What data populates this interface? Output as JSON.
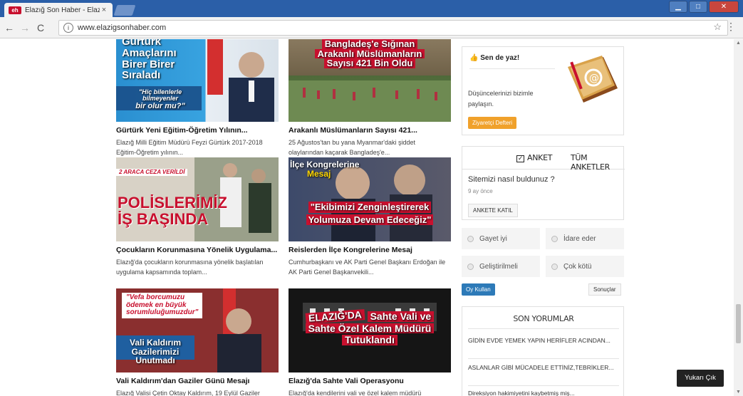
{
  "browser": {
    "tab_title": "Elazığ Son Haber - Elazığ",
    "favicon_text": "eh",
    "tab_close": "×",
    "url": "www.elazigsonhaber.com",
    "back": "←",
    "forward": "→",
    "reload": "C",
    "info": "i",
    "star": "☆",
    "menu": "⋮",
    "win_min": "▁",
    "win_max": "□",
    "win_close": "✕"
  },
  "news": [
    {
      "headline": "Gürtürk Yeni Eğitim-Öğretim Yılının...",
      "summary": "Elazığ Milli Eğitim Müdürü Feyzi Gürtürk  2017-2018 Eğitim-Öğretim yılının...",
      "overlay_lines": [
        "Gürtürk",
        "Amaçlarını",
        "Birer Birer",
        "Sıraladı"
      ],
      "overlay_quote": [
        "\"Hiç bilenlerle bilmeyenler",
        "bir olur mu?\""
      ]
    },
    {
      "headline": "Arakanlı Müslümanların Sayısı 421...",
      "summary": "25 Ağustos'tan bu yana Myanmar'daki şiddet olaylarından kaçarak Bangladeş'e...",
      "overlay_lines": [
        "Bangladeş'e Sığınan",
        "Arakanlı Müslümanların",
        "Sayısı 421 Bin Oldu"
      ]
    },
    {
      "headline": "Çocukların Korunmasına Yönelik Uygulama...",
      "summary": "Elazığ'da çocukların korunmasına yönelik başlatılan uygulama kapsamında toplam...",
      "overlay_lines": [
        "2 ARACA CEZA VERİLDİ",
        "POLİSLERİMİZ",
        "İŞ BAŞINDA"
      ]
    },
    {
      "headline": "Reislerden İlçe Kongrelerine Mesaj",
      "summary": "Cumhurbaşkanı ve AK Parti Genel Başkanı Erdoğan ile AK Parti Genel Başkanvekili...",
      "overlay_lines": [
        "İlçe Kongrelerine",
        "Mesaj",
        "\"Ekibimizi Zenginleştirerek",
        "Yolumuza Devam Edeceğiz\""
      ]
    },
    {
      "headline": "Vali Kaldırım'dan Gaziler Günü Mesajı",
      "summary": "Elazığ Valisi Çetin Oktay Kaldırım, 19 Eylül Gaziler",
      "overlay_lines": [
        "\"Vefa borcumuzu",
        "ödemek en büyük",
        "sorumluluğumuzdur\"",
        "Vali Kaldırım",
        "Gazilerimizi Unutmadı"
      ]
    },
    {
      "headline": "Elazığ'da Sahte Vali Operasyonu",
      "summary": "Elazığ'da kendilerini vali ve özel kalem müdürü",
      "overlay_lines": [
        "ELAZIĞ'DA",
        "Sahte Vali ve",
        "Sahte Özel Kalem Müdürü",
        "Tutuklandı"
      ]
    }
  ],
  "sidebar": {
    "senyaz": {
      "title": "👍 Sen de yaz!",
      "text": "Düşüncelerinizi bizimle paylaşın.",
      "button": "Ziyaretçi Defteri"
    },
    "poll": {
      "tab_anket": "ANKET",
      "tab_tum": "TÜM ANKETLER",
      "question": "Sitemizi nasıl buldunuz ?",
      "when": "9 ay önce",
      "join_button": "ANKETE KATIL",
      "options": [
        "Gayet iyi",
        "İdare eder",
        "Geliştirilmeli",
        "Çok kötü"
      ],
      "vote_button": "Oy Kullan",
      "results_button": "Sonuçlar"
    },
    "comments": {
      "title": "SON YORUMLAR",
      "items": [
        "GİDİN EVDE YEMEK YAPIN HERİFLER ACINDAN...",
        "ASLANLAR GİBİ MÜCADELE ETTİNİZ,TEBRİKLER...",
        "Direksiyon hakimiyetini kaybetmiş miş..."
      ]
    }
  },
  "back_to_top": "Yukarı Çık",
  "colors": {
    "chrome_blue": "#2b5fa8",
    "accent_orange": "#f0a12b",
    "vote_blue": "#2d7ab8",
    "overlay_red": "#c8102e"
  }
}
